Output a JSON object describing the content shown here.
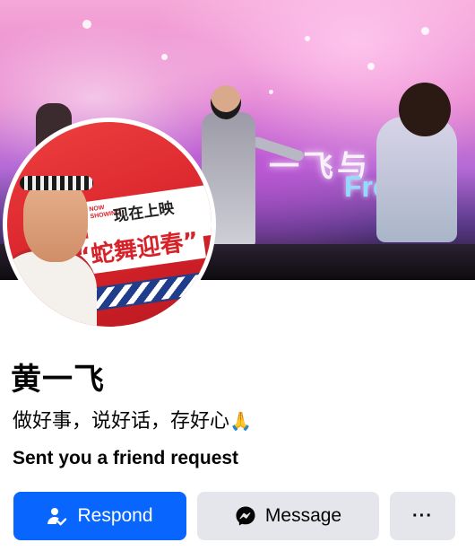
{
  "profile": {
    "name": "黄一飞",
    "bio": "做好事，说好话，存好心",
    "bio_emoji": "🙏",
    "request_status": "Sent you a friend request"
  },
  "avatar": {
    "sign_text": "现在上映",
    "sign_small_text": "NOW SHOWING",
    "banner_text": "“蛇舞迎春”"
  },
  "cover": {
    "screen_text": "一飞与",
    "screen_text_2": "Fre"
  },
  "actions": {
    "respond_label": "Respond",
    "message_label": "Message",
    "more_label": "···"
  },
  "colors": {
    "primary": "#0866ff",
    "secondary_button": "#e4e6eb",
    "text": "#050505"
  },
  "icons": {
    "respond": "person-check-icon",
    "message": "messenger-icon",
    "more": "more-dots-icon"
  }
}
